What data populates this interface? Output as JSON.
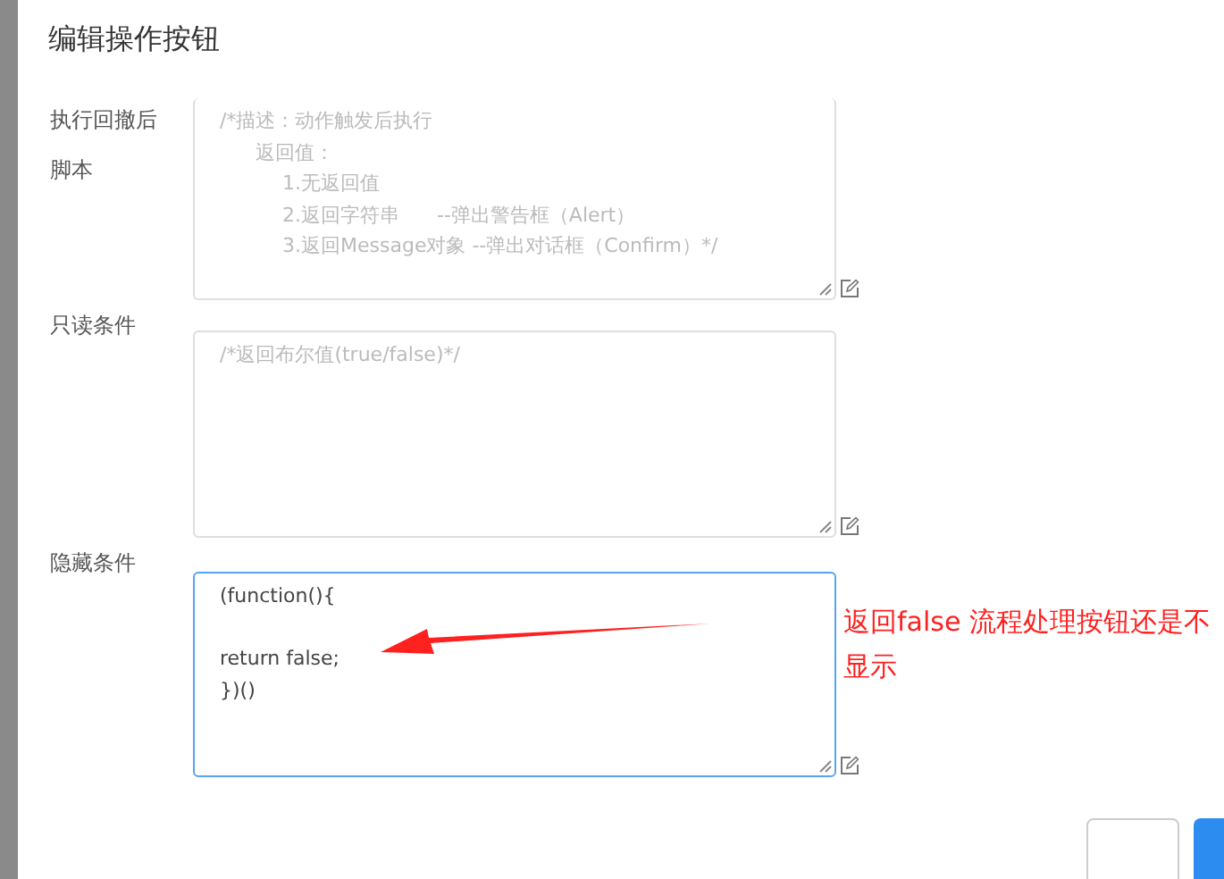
{
  "dialog": {
    "title": "编辑操作按钮"
  },
  "fields": [
    {
      "label": "执行回撤后脚本",
      "placeholder_lines": [
        "/*描述：动作触发后执行",
        "返回值：",
        "1.无返回值",
        "2.返回字符串      --弹出警告框（Alert）",
        "3.返回Message对象 --弹出对话框（Confirm）*/"
      ],
      "focused": false
    },
    {
      "label": "只读条件",
      "placeholder_lines": [
        "/*返回布尔值(true/false)*/"
      ],
      "focused": false
    },
    {
      "label": "隐藏条件",
      "value_lines": [
        "(function(){",
        "return false;",
        "})()"
      ],
      "focused": true
    }
  ],
  "annotation": {
    "text": "返回false 流程处理按钮还是不显示"
  }
}
